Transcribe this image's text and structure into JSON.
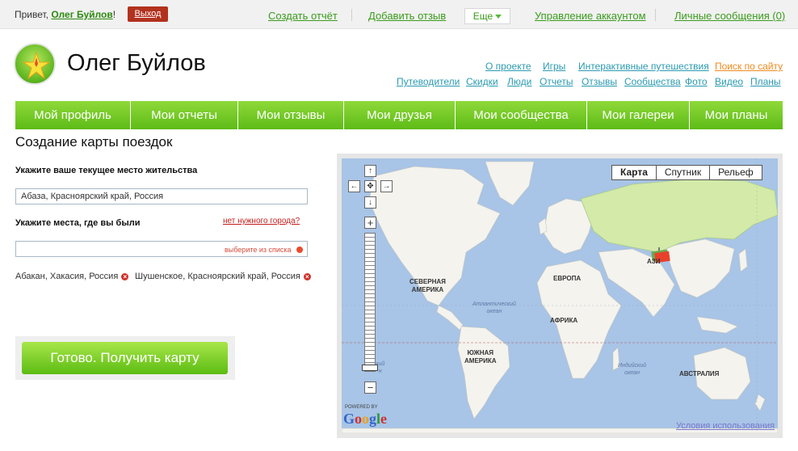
{
  "topbar": {
    "greeting": "Привет,",
    "username": "Олег Буйлов",
    "exclaim": "!",
    "logout": "Выход",
    "links": {
      "create_report": "Создать отчёт",
      "add_review": "Добавить отзыв",
      "more": "Еще",
      "account": "Управление аккаунтом",
      "messages": "Личные сообщения (0)"
    }
  },
  "header": {
    "site_name": "Олег Буйлов",
    "links_row1": [
      "О проекте",
      "Игры",
      "Интерактивные путешествия",
      "Поиск по сайту"
    ],
    "links_row2": [
      "Путеводители",
      "Скидки",
      "Люди",
      "Отчеты",
      "Отзывы",
      "Сообщества",
      "Фото",
      "Видео",
      "Планы"
    ]
  },
  "nav": [
    "Мой профиль",
    "Мои отчеты",
    "Мои отзывы",
    "Мои друзья",
    "Мои сообщества",
    "Мои галереи",
    "Мои планы"
  ],
  "form": {
    "title": "Создание карты поездок",
    "residence_label": "Укажите ваше текущее место жительства",
    "residence_value": "Абаза, Красноярский край, Россия",
    "visited_label": "Укажите места, где вы были",
    "missing_city": "нет нужного города?",
    "visited_hint": "выберите из списка",
    "visited_chips": [
      "Абакан, Хакасия, Россия",
      "Шушенское, Красноярский край, Россия"
    ],
    "submit": "Готово. Получить карту"
  },
  "map": {
    "types": [
      "Карта",
      "Спутник",
      "Рельеф"
    ],
    "selected_type": "Карта",
    "continents": {
      "north_america": "СЕВЕРНАЯ\nАМЕРИКА",
      "south_america": "ЮЖНАЯ\nАМЕРИКА",
      "europe": "ЕВРОПА",
      "africa": "АФРИКА",
      "australia": "АВСТРАЛИЯ",
      "asia_partial": "АЗИ"
    },
    "oceans": {
      "atlantic": "Атлантический\nокеан",
      "indian": "Индийский\nокеан",
      "pacific_partial": "хий\nн"
    },
    "powered_by": "POWERED BY",
    "google": "Google",
    "terms": "Условия использования",
    "colors": {
      "water": "#a8c4e6",
      "land": "#f4f3ee",
      "russia": "#d3eaa8",
      "marker": "#e8402a"
    }
  }
}
